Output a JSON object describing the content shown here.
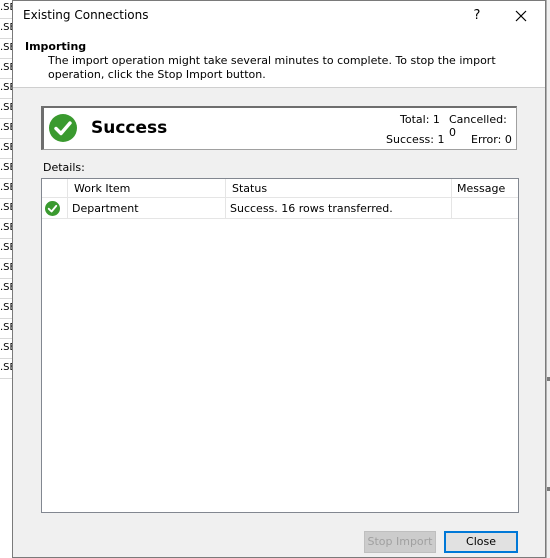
{
  "background": {
    "row_text": ".SE",
    "row_count": 19
  },
  "window": {
    "title": "Existing Connections",
    "help_label": "?",
    "close_label": "✕"
  },
  "header": {
    "title": "Importing",
    "description": "The import operation might take several minutes to complete. To stop the import operation, click the Stop Import button."
  },
  "status": {
    "icon": "success-check-icon",
    "text": "Success",
    "total_label": "Total: 1",
    "cancelled_label": "Cancelled: 0",
    "success_label": "Success: 1",
    "error_label": "Error: 0"
  },
  "details": {
    "label": "Details:",
    "columns": [
      "",
      "Work Item",
      "Status",
      "Message"
    ],
    "rows": [
      {
        "icon": "success-check-icon",
        "work_item": "Department",
        "status": "Success. 16 rows transferred.",
        "message": ""
      }
    ]
  },
  "buttons": {
    "stop_import": "Stop Import",
    "close": "Close"
  },
  "colors": {
    "success_green": "#3a9a2f",
    "accent_blue": "#0078d7"
  }
}
